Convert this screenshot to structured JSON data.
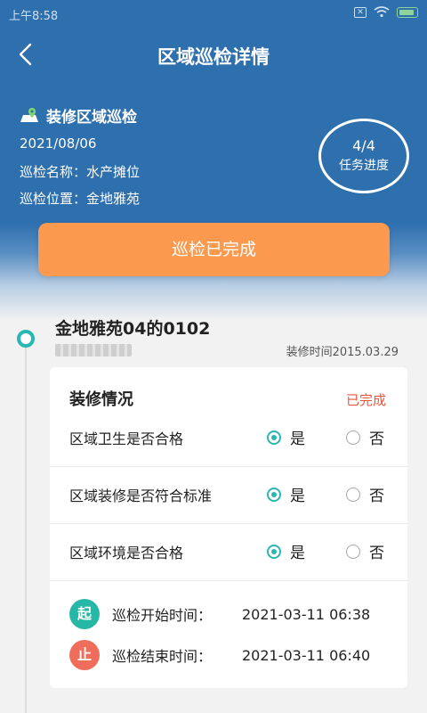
{
  "status_bar": {
    "time": "上午8:58"
  },
  "header": {
    "title": "区域巡检详情"
  },
  "inspection": {
    "type": "装修区域巡检",
    "date": "2021/08/06",
    "name_line": "巡检名称：水产摊位",
    "location_line": "巡检位置：金地雅苑"
  },
  "progress": {
    "count": "4/4",
    "label": "任务进度"
  },
  "status_button": {
    "label": "巡检已完成"
  },
  "record": {
    "site": "金地雅苑04的0102",
    "decor_time": "装修时间2015.03.29"
  },
  "card": {
    "title": "装修情况",
    "status": "已完成",
    "questions": [
      {
        "text": "区域卫生是否合格",
        "yes": "是",
        "no": "否",
        "answer": "是"
      },
      {
        "text": "区域装修是否符合标准",
        "yes": "是",
        "no": "否",
        "answer": "是"
      },
      {
        "text": "区域环境是否合格",
        "yes": "是",
        "no": "否",
        "answer": "是"
      }
    ],
    "start": {
      "badge": "起",
      "label": "巡检开始时间：",
      "value": "2021-03-11 06:38"
    },
    "end": {
      "badge": "止",
      "label": "巡检结束时间：",
      "value": "2021-03-11 06:40"
    }
  },
  "colors": {
    "header_blue": "#2e6fae",
    "accent_orange": "#fb9a4e",
    "teal": "#2ab7b4",
    "status_red": "#e8563e"
  }
}
